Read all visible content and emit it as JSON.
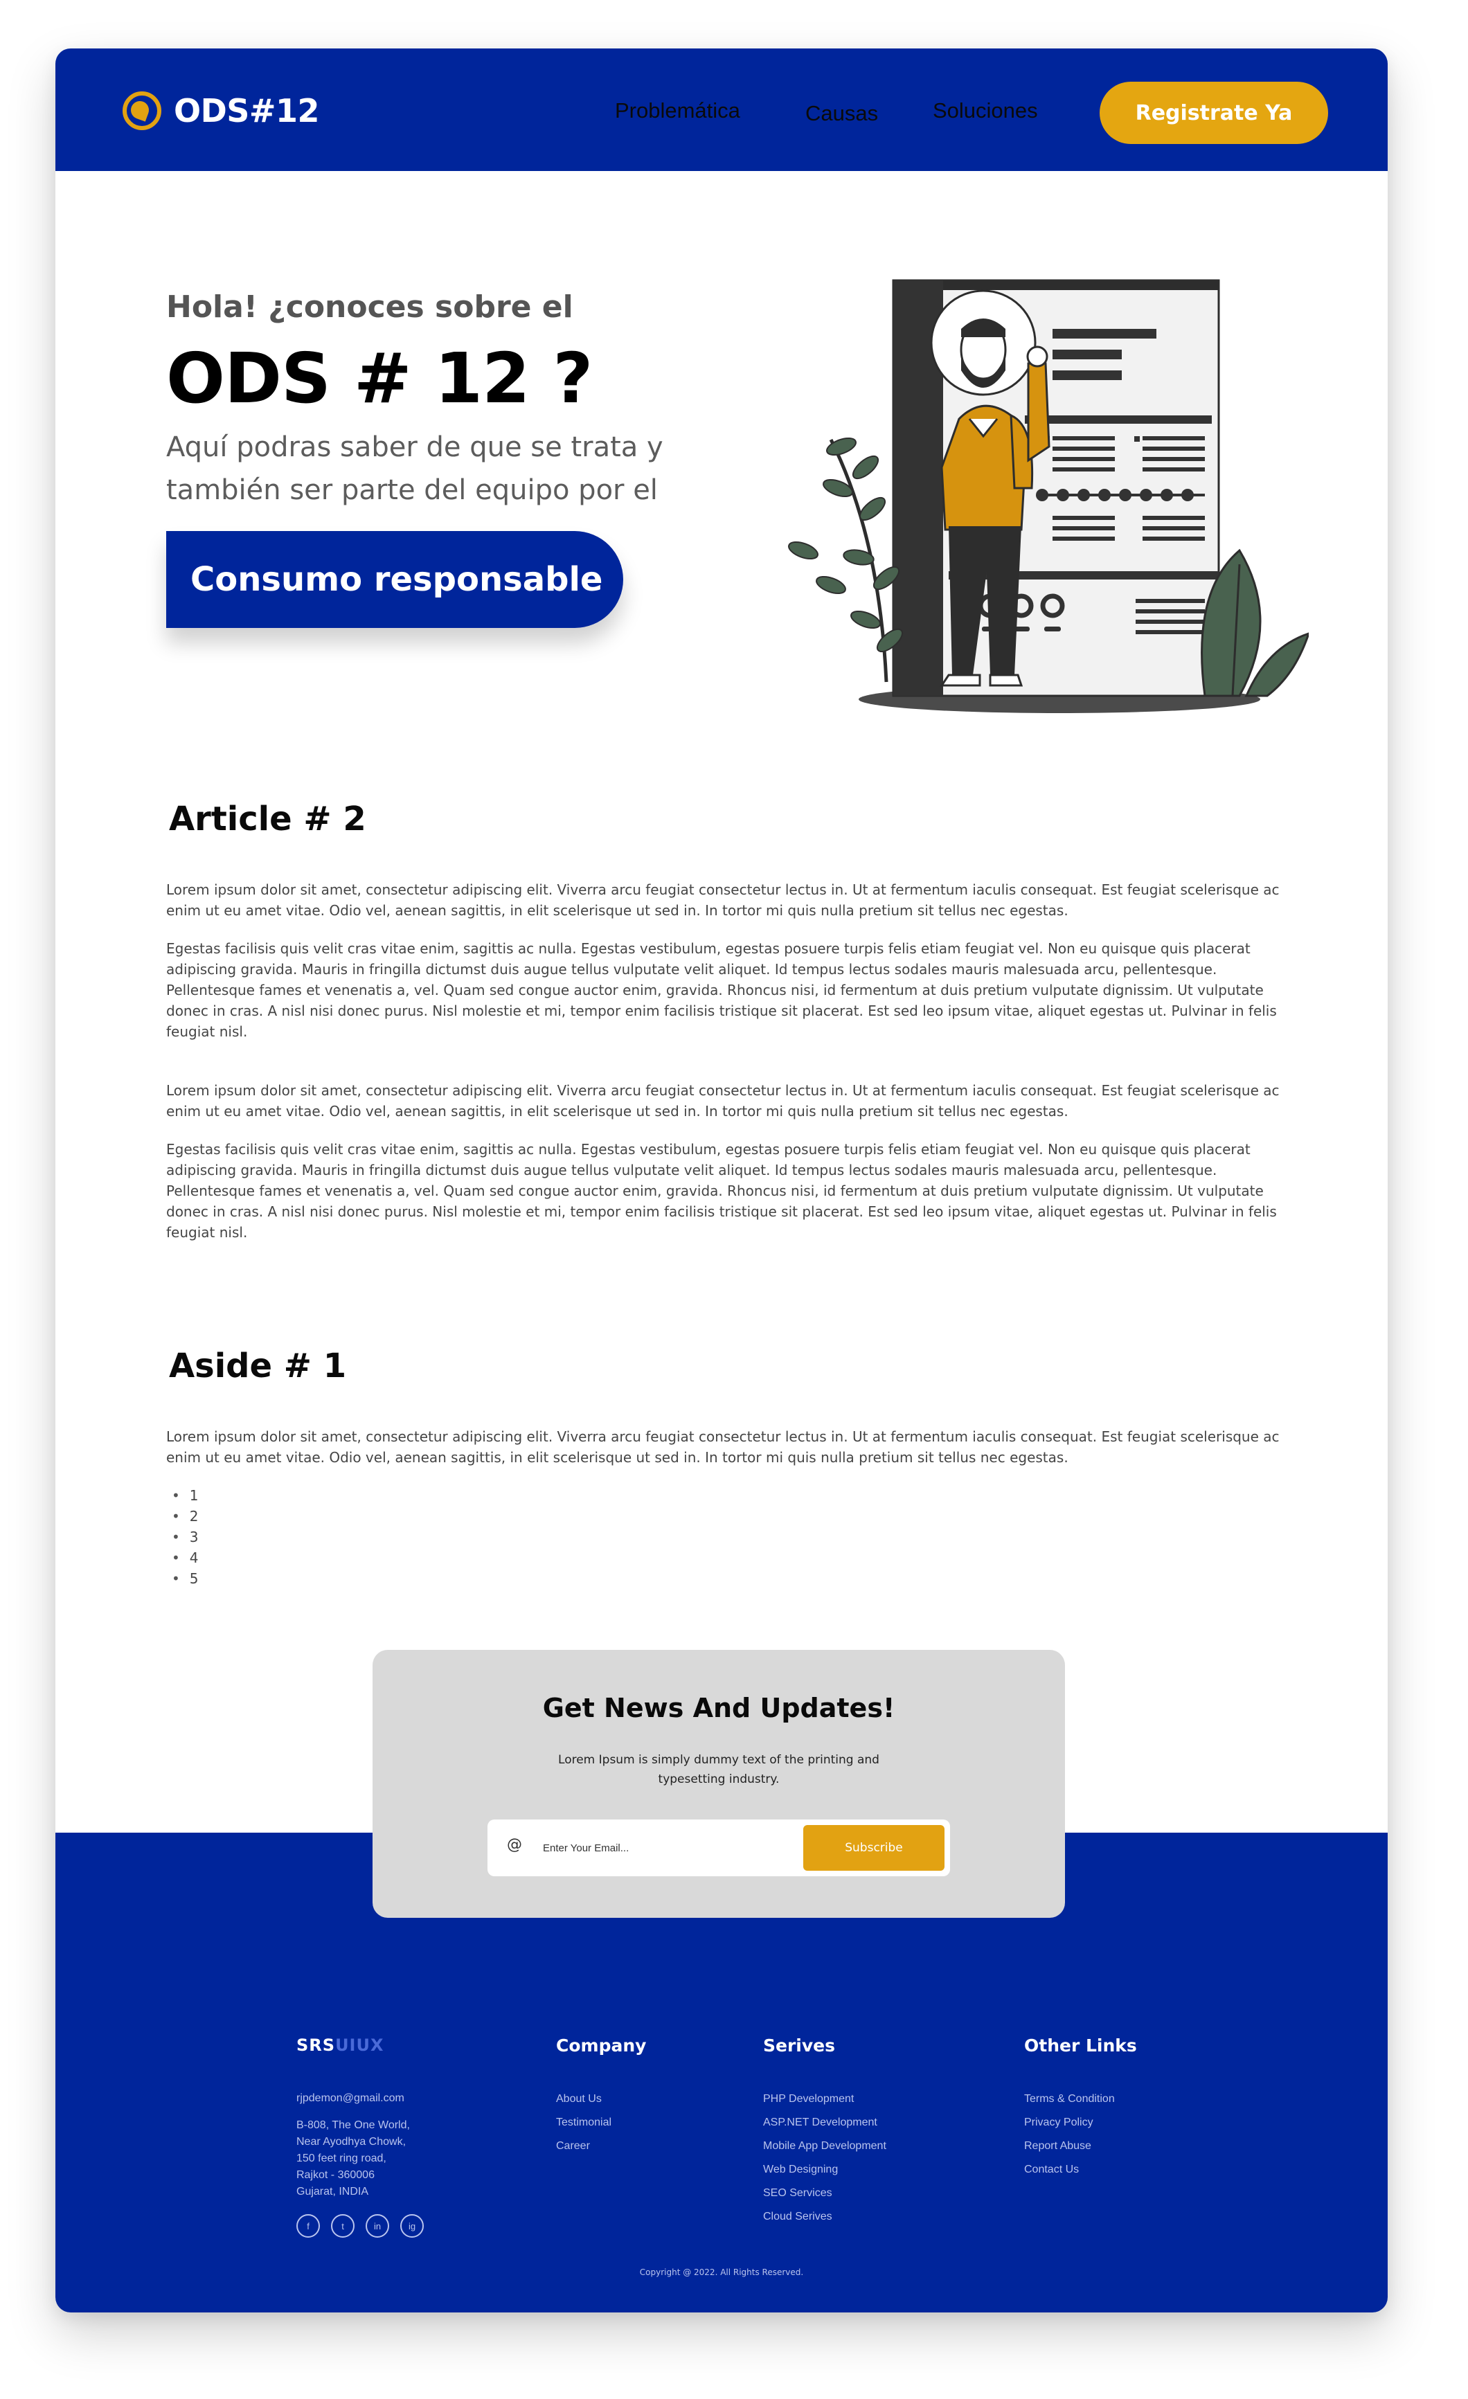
{
  "nav": {
    "logo_text": "ODS#12",
    "links": [
      "Problemática",
      "Causas",
      "Soluciones"
    ],
    "cta": "Registrate Ya"
  },
  "hero": {
    "kicker": "Hola! ¿conoces sobre el",
    "title": "ODS # 12 ?",
    "subtitle": "Aquí podras saber de que se trata y también ser parte del equipo por el",
    "button": "Consumo responsable"
  },
  "article": {
    "title": "Article # 2",
    "p1": "Lorem ipsum dolor sit amet, consectetur adipiscing elit. Viverra arcu feugiat consectetur lectus in. Ut at fermentum iaculis consequat. Est feugiat scelerisque ac enim ut eu amet vitae. Odio vel, aenean sagittis, in elit scelerisque ut sed in. In tortor mi quis nulla pretium sit tellus nec egestas.",
    "p2": "Egestas facilisis quis velit cras vitae enim, sagittis ac nulla. Egestas vestibulum, egestas posuere turpis felis etiam feugiat vel. Non eu quisque quis placerat adipiscing gravida. Mauris in fringilla dictumst duis augue tellus vulputate velit aliquet. Id tempus lectus sodales mauris malesuada arcu, pellentesque. Pellentesque fames et venenatis a, vel. Quam sed congue auctor enim, gravida. Rhoncus nisi, id fermentum at duis pretium vulputate dignissim. Ut vulputate donec in cras. A nisl nisi donec purus. Nisl molestie et mi, tempor enim facilisis tristique sit placerat. Est sed leo ipsum vitae, aliquet egestas ut. Pulvinar in felis feugiat nisl.",
    "p3": "Lorem ipsum dolor sit amet, consectetur adipiscing elit. Viverra arcu feugiat consectetur lectus in. Ut at fermentum iaculis consequat. Est feugiat scelerisque ac enim ut eu amet vitae. Odio vel, aenean sagittis, in elit scelerisque ut sed in. In tortor mi quis nulla pretium sit tellus nec egestas.",
    "p4": "Egestas facilisis quis velit cras vitae enim, sagittis ac nulla. Egestas vestibulum, egestas posuere turpis felis etiam feugiat vel. Non eu quisque quis placerat adipiscing gravida. Mauris in fringilla dictumst duis augue tellus vulputate velit aliquet. Id tempus lectus sodales mauris malesuada arcu, pellentesque. Pellentesque fames et venenatis a, vel. Quam sed congue auctor enim, gravida. Rhoncus nisi, id fermentum at duis pretium vulputate dignissim. Ut vulputate donec in cras. A nisl nisi donec purus. Nisl molestie et mi, tempor enim facilisis tristique sit placerat. Est sed leo ipsum vitae, aliquet egestas ut. Pulvinar in felis feugiat nisl."
  },
  "aside": {
    "title": "Aside # 1",
    "p1": "Lorem ipsum dolor sit amet, consectetur adipiscing elit. Viverra arcu feugiat consectetur lectus in. Ut at fermentum iaculis consequat. Est feugiat scelerisque ac enim ut eu amet vitae. Odio vel, aenean sagittis, in elit scelerisque ut sed in. In tortor mi quis nulla pretium sit tellus nec egestas.",
    "items": [
      "1",
      "2",
      "3",
      "4",
      "5"
    ]
  },
  "newsletter": {
    "title": "Get News And Updates!",
    "subtitle": "Lorem Ipsum is simply dummy text of the printing and typesetting industry.",
    "at_symbol": "@",
    "placeholder": "Enter Your Email...",
    "button": "Subscribe"
  },
  "footer": {
    "brand_a": "SRS",
    "brand_b": "UIUX",
    "email": "rjpdemon@gmail.com",
    "address": [
      "B-808, The One World,",
      "Near Ayodhya Chowk,",
      "150 feet ring road,",
      "Rajkot - 360006",
      "Gujarat, INDIA"
    ],
    "socials": [
      "f",
      "t",
      "in",
      "ig"
    ],
    "company": {
      "title": "Company",
      "links": [
        "About Us",
        "Testimonial",
        "Career"
      ]
    },
    "services": {
      "title": "Serives",
      "links": [
        "PHP Development",
        "ASP.NET Development",
        "Mobile App Development",
        "Web Designing",
        "SEO Services",
        "Cloud Serives"
      ]
    },
    "other": {
      "title": "Other Links",
      "links": [
        "Terms & Condition",
        "Privacy Policy",
        "Report Abuse",
        "Contact Us"
      ]
    },
    "copyright": "Copyright @ 2022. All Rights Reserved."
  },
  "colors": {
    "brand_blue": "#00259b",
    "accent_yellow": "#e2a212",
    "panel_gray": "#d9d9d9"
  }
}
